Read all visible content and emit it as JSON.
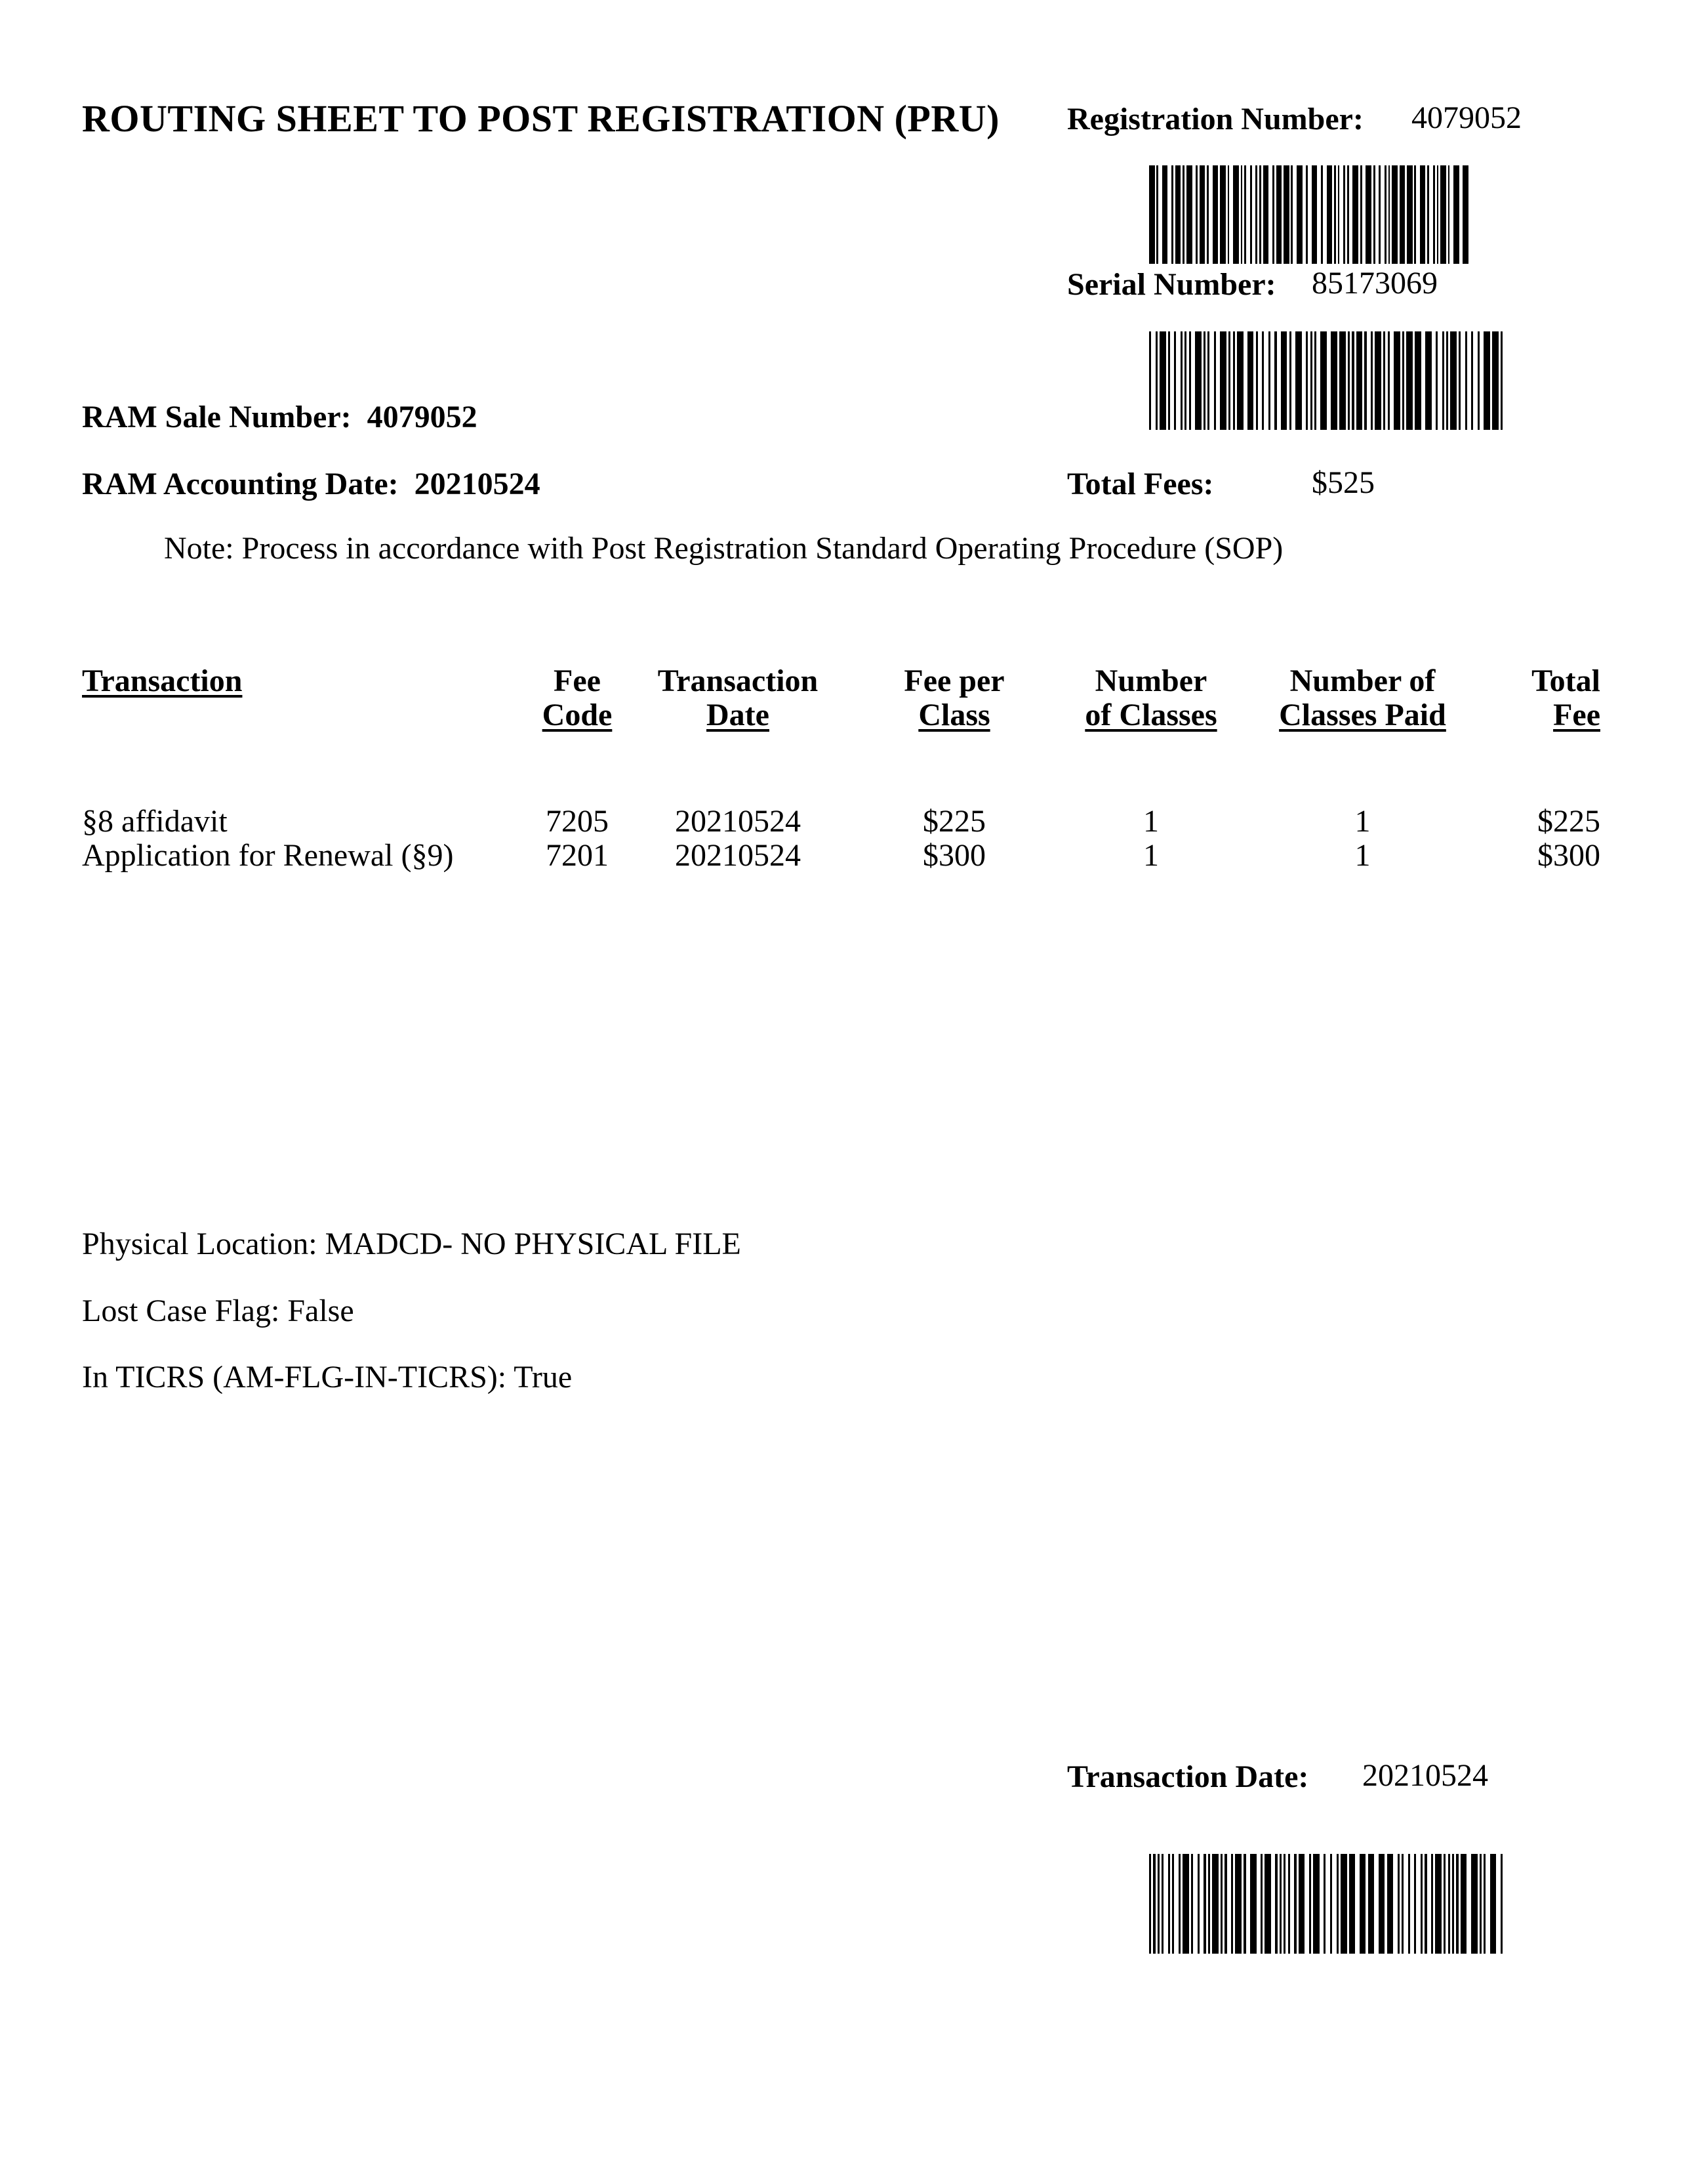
{
  "document": {
    "title": "ROUTING SHEET TO POST REGISTRATION (PRU)",
    "registration": {
      "label": "Registration Number:",
      "value": "4079052"
    },
    "serial": {
      "label": "Serial Number:",
      "value": "85173069"
    },
    "ram_sale": {
      "label": "RAM Sale Number:",
      "value": "4079052"
    },
    "ram_accounting": {
      "label": "RAM Accounting Date:",
      "value": "20210524"
    },
    "total_fees": {
      "label": "Total Fees:",
      "value": "$525"
    },
    "note": "Note:  Process in accordance with Post Registration Standard Operating Procedure (SOP)",
    "table": {
      "headers": {
        "transaction": [
          "Transaction"
        ],
        "fee_code": [
          "Fee",
          "Code"
        ],
        "transaction_date": [
          "Transaction",
          "Date"
        ],
        "fee_per_class": [
          "Fee per",
          "Class"
        ],
        "number_of_classes": [
          "Number",
          "of Classes"
        ],
        "number_of_classes_paid": [
          "Number of",
          "Classes Paid"
        ],
        "total_fee": [
          "Total",
          "Fee"
        ]
      },
      "rows": [
        {
          "transaction": "§8 affidavit",
          "fee_code": "7205",
          "transaction_date": "20210524",
          "fee_per_class": "$225",
          "number_of_classes": "1",
          "number_of_classes_paid": "1",
          "total_fee": "$225"
        },
        {
          "transaction": "Application for Renewal (§9)",
          "fee_code": "7201",
          "transaction_date": "20210524",
          "fee_per_class": "$300",
          "number_of_classes": "1",
          "number_of_classes_paid": "1",
          "total_fee": "$300"
        }
      ]
    },
    "physical_location": "Physical Location: MADCD- NO PHYSICAL FILE",
    "lost_case_flag": "Lost Case Flag: False",
    "in_ticrs": "In TICRS (AM-FLG-IN-TICRS): True",
    "footer_transaction_date": {
      "label": "Transaction Date:",
      "value": "20210524"
    },
    "barcodes": [
      {
        "name": "registration-barcode",
        "encodes": "4079052"
      },
      {
        "name": "serial-barcode",
        "encodes": "85173069"
      },
      {
        "name": "transaction-date-barcode",
        "encodes": "20210524"
      }
    ],
    "colors": {
      "ink": "#000000",
      "paper": "#ffffff"
    }
  }
}
